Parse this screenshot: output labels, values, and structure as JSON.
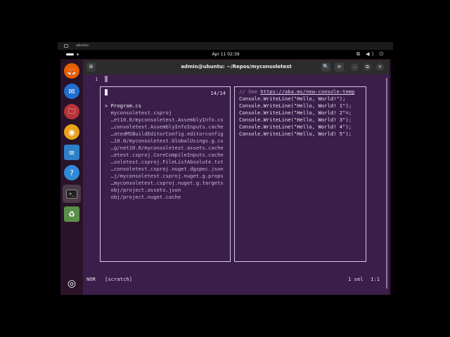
{
  "vm_bar": {
    "title": "ubuntu"
  },
  "topbar": {
    "clock": "Apr 11  02:39",
    "tray": "⧉ ◀) ⏻"
  },
  "dock": {
    "items": [
      {
        "name": "firefox-icon",
        "glyph": "🦊",
        "color": "#e66000"
      },
      {
        "name": "thunderbird-icon",
        "glyph": "✉",
        "color": "#1f6fd1"
      },
      {
        "name": "files-icon",
        "glyph": "🗀",
        "color": "#b8343a"
      },
      {
        "name": "rhythmbox-icon",
        "glyph": "◉",
        "color": "#e8a31a"
      },
      {
        "name": "writer-icon",
        "glyph": "≡",
        "color": "#2e80c7"
      },
      {
        "name": "help-icon",
        "glyph": "?",
        "color": "#2f8ad8"
      },
      {
        "name": "terminal-icon",
        "glyph": ">_",
        "color": "#2b2b2b"
      },
      {
        "name": "trash-icon",
        "glyph": "♻",
        "color": "#5a8f4a"
      }
    ],
    "show_apps_glyph": "◎"
  },
  "window": {
    "title": "admin@ubuntu: ~/Repos/myconsoletest",
    "new_tab_glyph": "⊞",
    "search_glyph": "🔍",
    "menu_glyph": "≡",
    "minimize_glyph": "–",
    "maximize_glyph": "⧉",
    "close_glyph": "✕"
  },
  "editor": {
    "line_number": "1",
    "picker": {
      "count": "14/14",
      "items": [
        "> Program.cs",
        "  myconsoletest.csproj",
        "  …et10.0/myconsoletest.AssemblyInfo.cs",
        "  …consoletest.AssemblyInfoInputs.cache",
        "  …atedMSBuildEditorConfig.editorconfig",
        "  …10.0/myconsoletest.GlobalUsings.g.cs",
        "  …g/net10.0/myconsoletest.assets.cache",
        "  …etest.csproj.CoreCompileInputs.cache",
        "  …soletest.csproj.FileListAbsolute.txt",
        "  …consoletest.csproj.nuget.dgspec.json",
        "  …j/myconsoletest.csproj.nuget.g.props",
        "  …myconsoletest.csproj.nuget.g.targets",
        "  obj/project.assets.json",
        "  obj/project.nuget.cache"
      ]
    },
    "preview": {
      "comment_prefix": "// See ",
      "comment_link": "https://aka.ms/new-console-temp",
      "lines": [
        "Console.WriteLine(\"Hello, World!\");",
        "Console.WriteLine(\"Hello, World! 1\");",
        "Console.WriteLine(\"Hello, World! 2\"=;",
        "Console.WriteLine(\"Hello, World! 3\");",
        "Console.WriteLine(\"Hello, World! 4\");",
        "Console.WriteLine(\"Hello, World! 5\");"
      ]
    },
    "status": {
      "mode": "NOR",
      "buffer": "[scratch]",
      "selections": "1 sel",
      "position": "1:1"
    }
  }
}
